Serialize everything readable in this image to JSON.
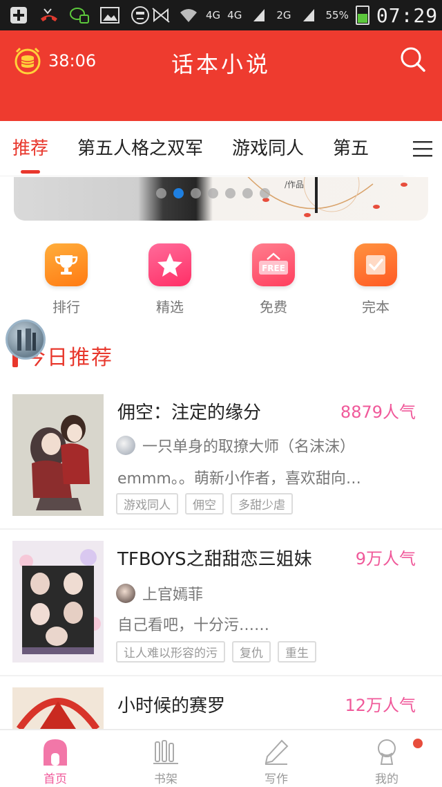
{
  "status_bar": {
    "network_4g_a": "4G",
    "network_4g_b": "4G",
    "network_2g": "2G",
    "battery_percent": "55%",
    "time": "07:29"
  },
  "header": {
    "timer": "38:06",
    "title": "话本小说"
  },
  "tabs": [
    {
      "label": "推荐"
    },
    {
      "label": "第五人格之双军"
    },
    {
      "label": "游戏同人"
    },
    {
      "label": "第五"
    }
  ],
  "banner": {
    "caption": "/作品",
    "active_dot": 2,
    "dot_count": 7
  },
  "quick_menu": [
    {
      "label": "排行",
      "icon": "trophy-icon",
      "color": "#ff8a1f"
    },
    {
      "label": "精选",
      "icon": "star-icon",
      "color": "#ff3f7a"
    },
    {
      "label": "免费",
      "icon": "free-icon",
      "color": "#ff4d6d"
    },
    {
      "label": "完本",
      "icon": "check-icon",
      "color": "#ff6a2e"
    }
  ],
  "section": {
    "title": "今日推荐"
  },
  "books": [
    {
      "title": "佣空：注定的缘分",
      "hot": "8879人气",
      "author": "一只单身的取撩大师（名沫沫）",
      "desc": "emmm。。萌新小作者，喜欢甜向…",
      "tags": [
        "游戏同人",
        "佣空",
        "多甜少虐"
      ]
    },
    {
      "title": "TFBOYS之甜甜恋三姐妹",
      "hot": "9万人气",
      "author": "上官嫣菲",
      "desc": "自己看吧，十分污……",
      "tags": [
        "让人难以形容的污",
        "复仇",
        "重生"
      ]
    },
    {
      "title": "小时候的赛罗",
      "hot": "12万人气"
    }
  ],
  "bottom_nav": [
    {
      "label": "首页",
      "icon": "home-icon"
    },
    {
      "label": "书架",
      "icon": "bookshelf-icon"
    },
    {
      "label": "写作",
      "icon": "pen-icon"
    },
    {
      "label": "我的",
      "icon": "profile-icon"
    }
  ],
  "colors": {
    "brand_red": "#ee3b2f",
    "accent_pink": "#f0599a",
    "active_dot": "#1e7fe0"
  }
}
